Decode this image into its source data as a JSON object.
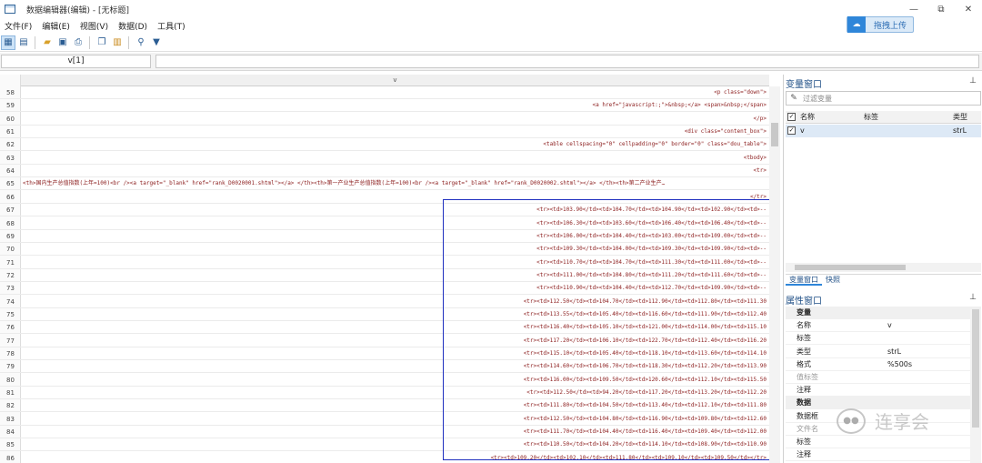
{
  "window": {
    "title": "数据编辑器(编辑) - [无标题]",
    "controls": [
      "—",
      "⧉",
      "✕"
    ]
  },
  "menu": [
    "文件(F)",
    "编辑(E)",
    "视图(V)",
    "数据(D)",
    "工具(T)"
  ],
  "upload_button": {
    "label": "拖拽上传"
  },
  "toolbar_icons": [
    "grid-view-icon",
    "list-view-icon",
    "open-folder-icon",
    "save-icon",
    "print-icon",
    "copy-icon",
    "paste-icon",
    "search-icon",
    "filter-icon"
  ],
  "cellref": "v[1]",
  "column_header": "v",
  "rows": [
    {
      "num": "58",
      "text": "<p class=\"down\">"
    },
    {
      "num": "59",
      "text": "<a href=\"javascript:;\">&nbsp;</a> <span>&nbsp;</span>"
    },
    {
      "num": "60",
      "text": "</p>"
    },
    {
      "num": "61",
      "text": "<div class=\"content_box\">"
    },
    {
      "num": "62",
      "text": "<table cellspacing=\"0\" cellpadding=\"0\" border=\"0\" class=\"dou_table\">"
    },
    {
      "num": "63",
      "text": "<tbody>"
    },
    {
      "num": "64",
      "text": "<tr>"
    },
    {
      "num": "65",
      "text": "<th>国内生产总值指数(上年=100)<br /><a target=\"_blank\" href=\"rank_D0020001.shtml\"></a> </th><th>第一产业生产总值指数(上年=100)<br /><a target=\"_blank\" href=\"rank_D0020002.shtml\"></a> </th><th>第二产业生产…"
    },
    {
      "num": "66",
      "text": "</tr>"
    },
    {
      "num": "67",
      "text": "<tr><td>103.90</td><td>104.70</td><td>104.90</td><td>102.90</td><td>--"
    },
    {
      "num": "68",
      "text": "<tr><td>106.30</td><td>103.60</td><td>106.40</td><td>106.40</td><td>--"
    },
    {
      "num": "69",
      "text": "<tr><td>106.00</td><td>104.40</td><td>103.00</td><td>109.00</td><td>--"
    },
    {
      "num": "70",
      "text": "<tr><td>109.30</td><td>104.00</td><td>109.30</td><td>109.90</td><td>--"
    },
    {
      "num": "71",
      "text": "<tr><td>110.70</td><td>104.70</td><td>111.30</td><td>111.00</td><td>--"
    },
    {
      "num": "72",
      "text": "<tr><td>111.00</td><td>104.80</td><td>111.20</td><td>111.60</td><td>--"
    },
    {
      "num": "73",
      "text": "<tr><td>110.90</td><td>104.40</td><td>112.70</td><td>109.90</td><td>--"
    },
    {
      "num": "74",
      "text": "<tr><td>112.50</td><td>104.70</td><td>112.90</td><td>112.80</td><td>111.30"
    },
    {
      "num": "75",
      "text": "<tr><td>113.55</td><td>105.40</td><td>116.60</td><td>111.90</td><td>112.40"
    },
    {
      "num": "76",
      "text": "<tr><td>116.40</td><td>105.10</td><td>121.00</td><td>114.00</td><td>115.10"
    },
    {
      "num": "77",
      "text": "<tr><td>117.20</td><td>106.10</td><td>122.70</td><td>112.40</td><td>116.20"
    },
    {
      "num": "78",
      "text": "<tr><td>115.10</td><td>105.40</td><td>118.10</td><td>113.60</td><td>114.10"
    },
    {
      "num": "79",
      "text": "<tr><td>114.60</td><td>106.70</td><td>118.30</td><td>112.20</td><td>113.90"
    },
    {
      "num": "80",
      "text": "<tr><td>116.00</td><td>109.50</td><td>120.60</td><td>112.10</td><td>115.50"
    },
    {
      "num": "81",
      "text": "<tr><td>112.50</td><td>94.20</td><td>117.20</td><td>113.20</td><td>112.20"
    },
    {
      "num": "82",
      "text": "<tr><td>111.80</td><td>104.50</td><td>113.40</td><td>112.10</td><td>111.80"
    },
    {
      "num": "83",
      "text": "<tr><td>112.50</td><td>104.80</td><td>116.90</td><td>109.80</td><td>112.60"
    },
    {
      "num": "84",
      "text": "<tr><td>111.70</td><td>104.40</td><td>116.40</td><td>109.40</td><td>112.00"
    },
    {
      "num": "85",
      "text": "<tr><td>110.50</td><td>104.20</td><td>114.10</td><td>108.90</td><td>110.90"
    },
    {
      "num": "86",
      "text": "<tr><td>109.20</td><td>102.10</td><td>111.80</td><td>109.10</td><td>109.50</td></tr>"
    }
  ],
  "variables": {
    "title": "变量窗口",
    "pin": "⊥",
    "filter_placeholder": "过滤变量",
    "columns": {
      "name": "名称",
      "label": "标签",
      "type": "类型"
    },
    "items": [
      {
        "name": "v",
        "label": "",
        "type": "strL"
      }
    ],
    "tabs": [
      "变量窗口",
      "快照"
    ]
  },
  "properties": {
    "title": "属性窗口",
    "pin": "⊥",
    "rows": [
      {
        "name": "变量",
        "value": "",
        "group": true
      },
      {
        "name": "名称",
        "value": "v"
      },
      {
        "name": "标签",
        "value": ""
      },
      {
        "name": "类型",
        "value": "strL"
      },
      {
        "name": "格式",
        "value": "%500s"
      },
      {
        "name": "值标签",
        "value": "",
        "dim": true
      },
      {
        "name": "注释",
        "value": ""
      },
      {
        "name": "数据",
        "value": "",
        "group": true
      },
      {
        "name": "数据框",
        "value": ""
      },
      {
        "name": "文件名",
        "value": "",
        "dim": true
      },
      {
        "name": "标签",
        "value": ""
      },
      {
        "name": "注释",
        "value": ""
      }
    ]
  },
  "watermark": "连享会"
}
